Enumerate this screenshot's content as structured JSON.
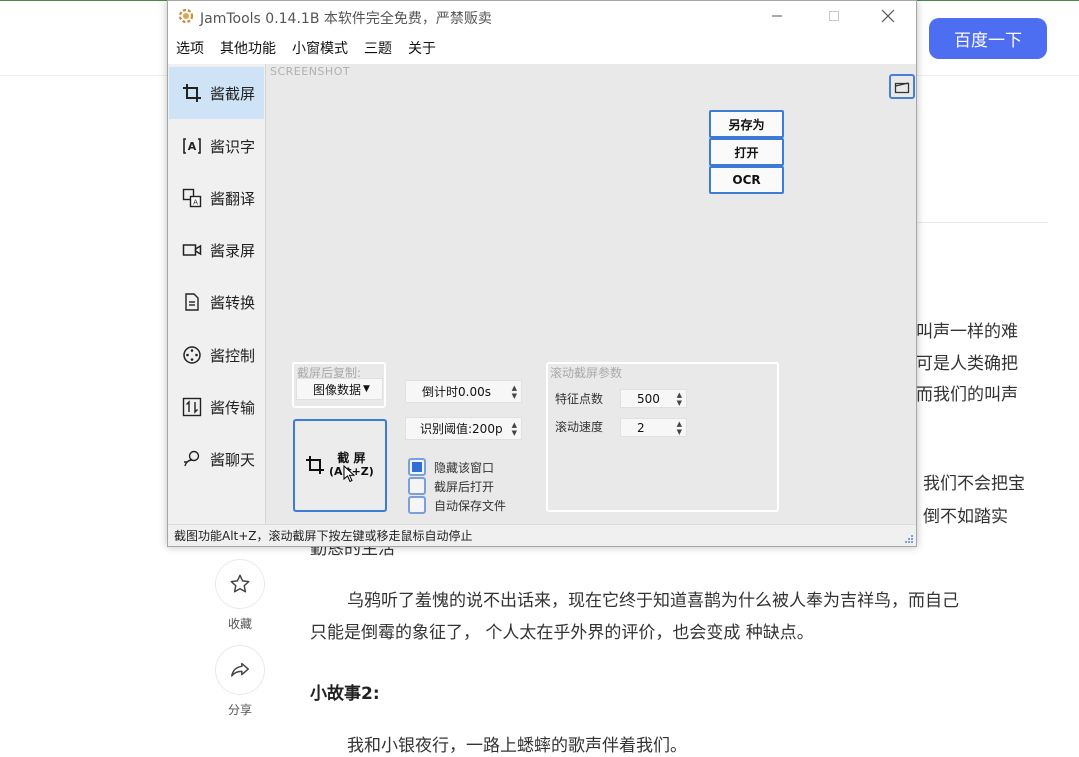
{
  "browser": {
    "search_button": "百度一下",
    "article_fragments": [
      {
        "id": "f1",
        "text": "叫声一样的难"
      },
      {
        "id": "f2",
        "text": "可是人类确把"
      },
      {
        "id": "f3",
        "text": "而我们的叫声"
      },
      {
        "id": "f4",
        "text": "，我们不会把宝"
      },
      {
        "id": "f5",
        "text": "，倒不如踏实"
      },
      {
        "id": "f6",
        "text": "勤恳的生活"
      }
    ],
    "side_actions": [
      {
        "label": "收藏",
        "icon": "star-icon"
      },
      {
        "label": "分享",
        "icon": "share-icon"
      }
    ],
    "paragraph_1_line_1": "乌鸦听了羞愧的说不出话来，现在它终于知道喜鹊为什么被人奉为吉祥鸟，而自己",
    "paragraph_1_line_2": "只能是倒霉的象征了，  个人太在乎外界的评价，也会变成  种缺点。",
    "heading": "小故事2:",
    "paragraph_2_line_1": "我和小银夜行，一路上蟋蟀的歌声伴着我们。"
  },
  "app": {
    "title": "JamTools 0.14.1B 本软件完全免费，严禁贩卖",
    "menu": [
      "选项",
      "其他功能",
      "小窗模式",
      "三题",
      "关于"
    ],
    "sidebar": [
      {
        "label": "酱截屏",
        "icon": "crop-icon",
        "active": true
      },
      {
        "label": "酱识字",
        "icon": "ocr-text-icon",
        "active": false
      },
      {
        "label": "酱翻译",
        "icon": "translate-icon",
        "active": false
      },
      {
        "label": "酱录屏",
        "icon": "video-camera-icon",
        "active": false
      },
      {
        "label": "酱转换",
        "icon": "convert-file-icon",
        "active": false
      },
      {
        "label": "酱控制",
        "icon": "remote-control-icon",
        "active": false
      },
      {
        "label": "酱传输",
        "icon": "transfer-icon",
        "active": false
      },
      {
        "label": "酱聊天",
        "icon": "chat-icon",
        "active": false
      }
    ],
    "screenshot_label": "SCREENSHOT",
    "actions": {
      "save_as": "另存为",
      "open": "打开",
      "ocr": "OCR"
    },
    "copy_group": {
      "title": "截屏后复制:",
      "selected": "图像数据"
    },
    "countdown": "倒计时0.00s",
    "threshold": "识别阈值:200p",
    "shot_button": {
      "line1": "截 屏",
      "line2": "(Alt+Z)"
    },
    "checkboxes": [
      {
        "label": "隐藏该窗口",
        "checked": true
      },
      {
        "label": "截屏后打开",
        "checked": false
      },
      {
        "label": "自动保存文件",
        "checked": false
      }
    ],
    "scroll_group": {
      "title": "滚动截屏参数",
      "feature_points_label": "特征点数",
      "feature_points_value": "500",
      "scroll_speed_label": "滚动速度",
      "scroll_speed_value": "2"
    },
    "status": "截图功能Alt+Z，滚动截屏下按左键或移走鼠标自动停止"
  },
  "colors": {
    "accent": "#3c7bd8",
    "baidu_blue": "#4e6ef2",
    "active_side": "#cfe3f7"
  }
}
